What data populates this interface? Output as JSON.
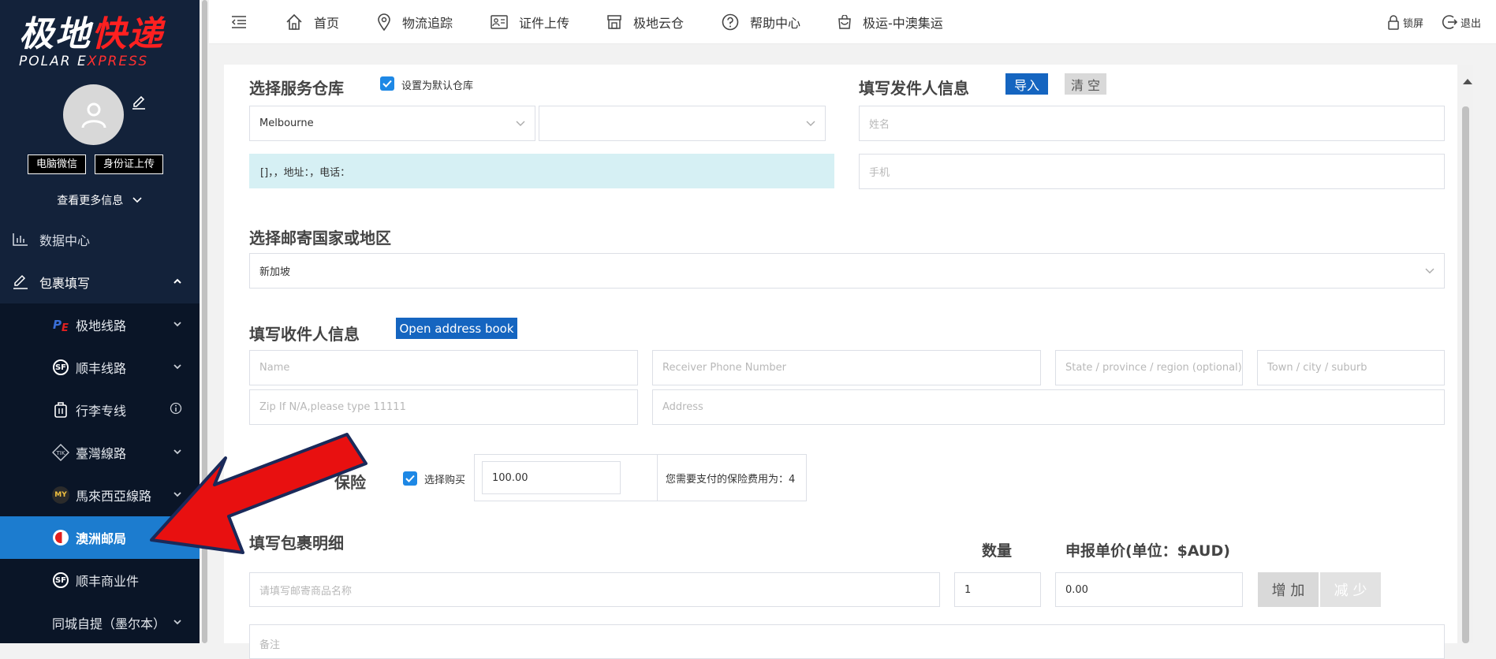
{
  "logo": {
    "cn_white": "极地",
    "cn_red": "快递",
    "en_white": "POLAR E",
    "en_red": "XPRESS"
  },
  "sidebar": {
    "wechat_btn": "电脑微信",
    "id_upload_btn": "身份证上传",
    "more_info": "查看更多信息",
    "items": [
      {
        "label": "数据中心",
        "icon": "bar-chart-icon"
      },
      {
        "label": "包裹填写",
        "icon": "edit-icon"
      }
    ],
    "sub_items": [
      {
        "label": "极地线路",
        "icon": "pe-logo-icon"
      },
      {
        "label": "顺丰线路",
        "icon": "sf-logo-icon"
      },
      {
        "label": "行李专线",
        "icon": "luggage-icon"
      },
      {
        "label": "臺灣線路",
        "icon": "taiwan-route-icon"
      },
      {
        "label": "馬來西亞線路",
        "icon": "my-logo-icon"
      },
      {
        "label": "澳洲邮局",
        "icon": "auspost-icon"
      },
      {
        "label": "顺丰商业件",
        "icon": "sf-logo-icon"
      },
      {
        "label": "同城自提（墨尔本）",
        "icon": ""
      }
    ],
    "active_color": "#1c7ccf",
    "bg_color": "#13223a"
  },
  "topbar": {
    "items": [
      {
        "label": "首页",
        "icon": "home-icon"
      },
      {
        "label": "物流追踪",
        "icon": "location-icon"
      },
      {
        "label": "证件上传",
        "icon": "id-card-icon"
      },
      {
        "label": "极地云仓",
        "icon": "warehouse-icon"
      },
      {
        "label": "帮助中心",
        "icon": "help-icon"
      },
      {
        "label": "极运-中澳集运",
        "icon": "bag-icon"
      }
    ],
    "lock_label": "锁屏",
    "logout_label": "退出"
  },
  "warehouse": {
    "title": "选择服务仓库",
    "default_label": "设置为默认仓库",
    "city": "Melbourne",
    "second": "",
    "info": "[]，，地址：，电话："
  },
  "sender": {
    "title": "填写发件人信息",
    "import_label": "导入",
    "clear_label": "清 空",
    "name_placeholder": "姓名",
    "phone_placeholder": "手机"
  },
  "country": {
    "title": "选择邮寄国家或地区",
    "value": "新加坡"
  },
  "receiver": {
    "title": "填写收件人信息",
    "address_book_label": "Open address book",
    "name_placeholder": "Name",
    "phone_placeholder": "Receiver Phone Number",
    "state_placeholder": "State / province / region (optional)",
    "town_placeholder": "Town / city / suburb",
    "zip_placeholder": "Zip If N/A,please type 11111",
    "address_placeholder": "Address"
  },
  "insurance": {
    "title_visible": "保险",
    "buy_label": "选择购买",
    "amount": "100.00",
    "fee_text": "您需要支付的保险费用为：4"
  },
  "parcel": {
    "title": "填写包裹明细",
    "qty_label": "数量",
    "price_label": "申报单价(单位：$AUD)",
    "name_placeholder": "请填写邮寄商品名称",
    "qty": "1",
    "price": "0.00",
    "add_label": "增 加",
    "remove_label": "减 少",
    "note_placeholder": "备注"
  },
  "annotation": {
    "arrow_color": "#e81010"
  }
}
